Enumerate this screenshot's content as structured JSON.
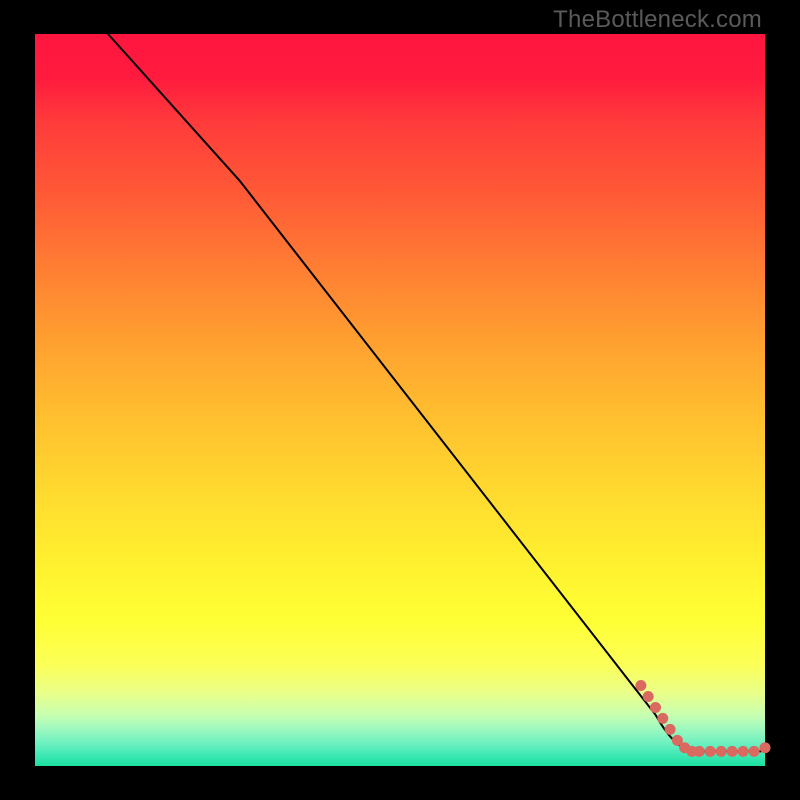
{
  "attribution": "TheBottleneck.com",
  "chart_data": {
    "type": "line",
    "title": "",
    "xlabel": "",
    "ylabel": "",
    "xlim": [
      0,
      100
    ],
    "ylim": [
      0,
      100
    ],
    "curve_points": [
      {
        "x": 10,
        "y": 100
      },
      {
        "x": 28,
        "y": 80
      },
      {
        "x": 85,
        "y": 7
      },
      {
        "x": 90,
        "y": 2
      },
      {
        "x": 100,
        "y": 2
      }
    ],
    "markers": [
      {
        "x": 83,
        "y": 11
      },
      {
        "x": 84,
        "y": 9.5
      },
      {
        "x": 85,
        "y": 8
      },
      {
        "x": 86,
        "y": 6.5
      },
      {
        "x": 87,
        "y": 5
      },
      {
        "x": 88,
        "y": 3.5
      },
      {
        "x": 89,
        "y": 2.5
      },
      {
        "x": 90,
        "y": 2
      },
      {
        "x": 91,
        "y": 2
      },
      {
        "x": 92.5,
        "y": 2
      },
      {
        "x": 94,
        "y": 2
      },
      {
        "x": 95.5,
        "y": 2
      },
      {
        "x": 97,
        "y": 2
      },
      {
        "x": 98.5,
        "y": 2
      },
      {
        "x": 100,
        "y": 2.5
      }
    ]
  },
  "colors": {
    "background": "#000000",
    "attribution_text": "#5a5a5a",
    "curve": "#000000",
    "marker": "#da6a5f",
    "gradient_top": "#ff163f",
    "gradient_bottom": "#1be09f"
  }
}
